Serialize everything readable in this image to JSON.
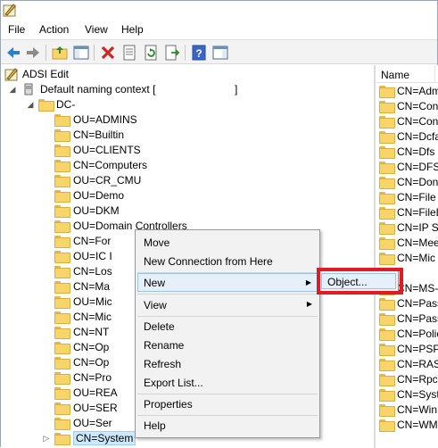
{
  "menubar": {
    "items": [
      "File",
      "Action",
      "View",
      "Help"
    ]
  },
  "tree": {
    "root": "ADSI Edit",
    "context": "Default naming context [",
    "context_end": "]",
    "dc": "DC-",
    "items": [
      "OU=ADMINS",
      "CN=Builtin",
      "OU=CLIENTS",
      "CN=Computers",
      "OU=CR_CMU",
      "OU=Demo",
      "OU=DKM",
      "OU=Domain Controllers",
      "CN=For",
      "OU=IC I",
      "CN=Los",
      "CN=Ma",
      "OU=Mic",
      "CN=Mic",
      "CN=NT",
      "CN=Op",
      "CN=Op",
      "CN=Pro",
      "OU=REA",
      "OU=SER",
      "OU=Ser",
      "CN=System"
    ]
  },
  "list": {
    "header": "Name",
    "items": [
      "CN=Adm",
      "CN=Con",
      "CN=Con",
      "CN=Dcfa",
      "CN=Dfs",
      "CN=DFSI",
      "CN=Don",
      "CN=File",
      "CN=FileL",
      "CN=IP Se",
      "CN=Mee",
      "CN=Mic",
      "",
      "CN=MS-",
      "CN=Pass",
      "CN=Pass",
      "CN=Polic",
      "CN=PSPs",
      "CN=RAS",
      "CN=Rpc",
      "CN=Syst",
      "CN=Win",
      "CN=WM"
    ]
  },
  "context_menu": {
    "move": "Move",
    "new_connection": "New Connection from Here",
    "new": "New",
    "view": "View",
    "delete": "Delete",
    "rename": "Rename",
    "refresh": "Refresh",
    "export_list": "Export List...",
    "properties": "Properties",
    "help": "Help"
  },
  "submenu": {
    "object": "Object..."
  },
  "colors": {
    "highlight": "#e01b24",
    "selection": "#cce8ff"
  }
}
